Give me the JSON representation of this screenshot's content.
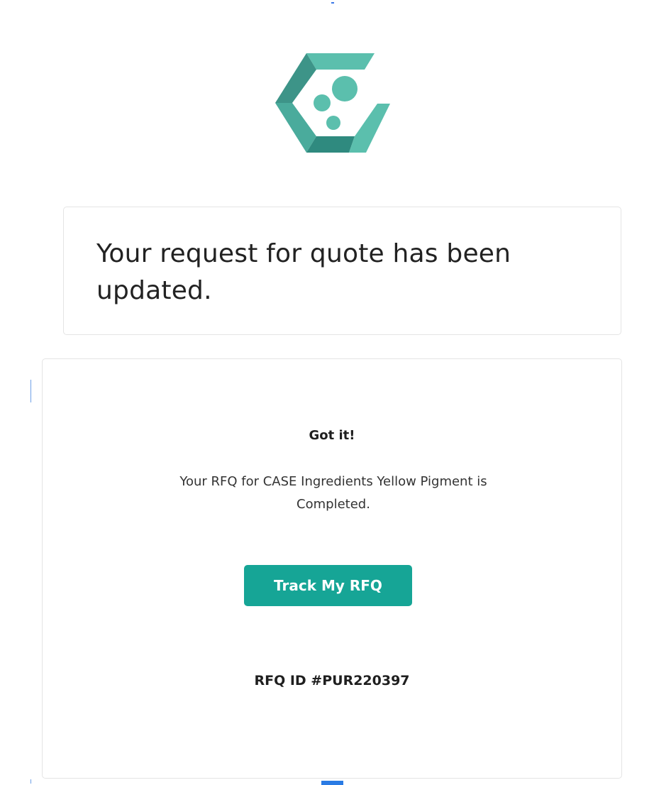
{
  "brand": {
    "logo": "hexagon-bubbles-logo",
    "colors": {
      "primary": "#5bbfad",
      "dark": "#3d9488",
      "light": "#8fd4c7"
    }
  },
  "headline": {
    "text": "Your request for quote has been updated."
  },
  "details": {
    "title": "Got it!",
    "message": "Your RFQ for CASE Ingredients Yellow Pigment is Completed.",
    "button_label": "Track My RFQ",
    "button_color": "#16a596",
    "rfq_id": "RFQ ID #PUR220397"
  }
}
